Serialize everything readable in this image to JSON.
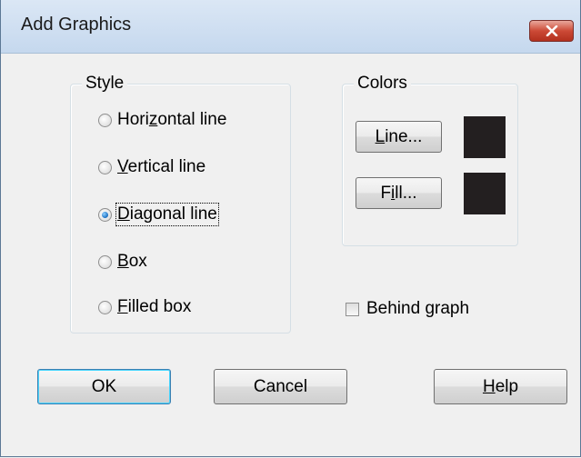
{
  "window": {
    "title": "Add Graphics"
  },
  "style_group": {
    "legend": "Style",
    "options": [
      {
        "pre": "Hori",
        "mn": "z",
        "post": "ontal line",
        "checked": false
      },
      {
        "pre": "",
        "mn": "V",
        "post": "ertical line",
        "checked": false
      },
      {
        "pre": "",
        "mn": "D",
        "post": "iagonal line",
        "checked": true
      },
      {
        "pre": "",
        "mn": "B",
        "post": "ox",
        "checked": false
      },
      {
        "pre": "",
        "mn": "F",
        "post": "illed box",
        "checked": false
      }
    ]
  },
  "colors_group": {
    "legend": "Colors",
    "line_button": {
      "mn": "L",
      "post": "ine..."
    },
    "fill_button": {
      "pre": "F",
      "mn": "i",
      "post": "ll..."
    },
    "line_color": "#231f20",
    "fill_color": "#231f20"
  },
  "behind_graph": {
    "pre": "Behind ",
    "mn": "g",
    "post": "raph",
    "checked": false
  },
  "buttons": {
    "ok": "OK",
    "cancel": "Cancel",
    "help": {
      "mn": "H",
      "post": "elp"
    }
  }
}
